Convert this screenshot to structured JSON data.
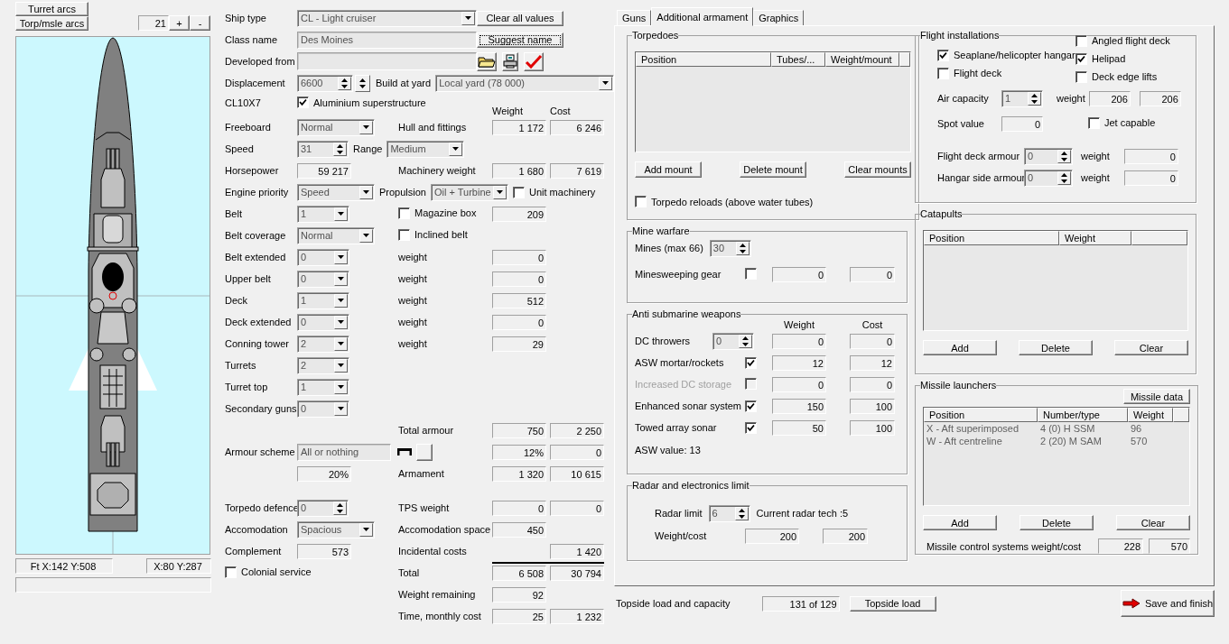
{
  "left_panel": {
    "arc_buttons": [
      "Turret arcs",
      "Torp/msle arcs"
    ],
    "zoom": {
      "value": "21",
      "buttons": [
        "+",
        "-"
      ]
    },
    "status": [
      "Ft X:142 Y:508",
      "X:80 Y:287"
    ]
  },
  "header": {
    "ship_type": {
      "label": "Ship type",
      "value": "CL - Light cruiser"
    },
    "clear_button": "Clear all values",
    "class_name": {
      "label": "Class name",
      "value": "Des Moines"
    },
    "suggest_button": {
      "label": "Suggest name",
      "focused": true
    },
    "developed_from": {
      "label": "Developed from"
    },
    "displacement": {
      "label": "Displacement",
      "value": "6600"
    },
    "yard": {
      "label": "Build at yard",
      "value": "Local yard (78 000)"
    },
    "code": "CL10X7",
    "aluminium": {
      "label": "Aluminium superstructure",
      "checked": true
    }
  },
  "columns": [
    "Weight",
    "Cost"
  ],
  "rows": [
    {
      "label": "Freeboard",
      "left": [
        {
          "kind": "dropdown",
          "value": "Normal"
        }
      ],
      "right_label": "Hull and fittings",
      "weight": "1 172",
      "cost": "6 246"
    },
    {
      "label": "Speed",
      "left": [
        {
          "kind": "spinner",
          "value": "31"
        },
        {
          "kind": "text",
          "text": "Range"
        },
        {
          "kind": "dropdown",
          "value": "Medium"
        }
      ]
    },
    {
      "label": "Horsepower",
      "left": [
        {
          "kind": "readout",
          "value": "59 217"
        }
      ],
      "right_label": "Machinery weight",
      "weight": "1 680",
      "cost": "7 619"
    },
    {
      "label": "Engine priority",
      "left": [
        {
          "kind": "dropdown",
          "value": "Speed"
        },
        {
          "kind": "text",
          "text": "Propulsion"
        },
        {
          "kind": "dropdown",
          "value": "Oil + Turbine"
        },
        {
          "kind": "checkbox",
          "label": "Unit machinery",
          "checked": false
        }
      ]
    },
    {
      "label": "Belt",
      "left": [
        {
          "kind": "narrow_dropdown",
          "value": "1"
        }
      ],
      "mid_check": {
        "label": "Magazine box",
        "checked": false
      },
      "weight": "209"
    },
    {
      "label": "Belt coverage",
      "left": [
        {
          "kind": "dropdown",
          "value": "Normal"
        }
      ],
      "mid_check": {
        "label": "Inclined belt",
        "checked": false
      }
    },
    {
      "label": "Belt extended",
      "left": [
        {
          "kind": "narrow_dropdown",
          "value": "0"
        }
      ],
      "right_label": "weight",
      "weight": "0"
    },
    {
      "label": "Upper belt",
      "left": [
        {
          "kind": "narrow_dropdown",
          "value": "0"
        }
      ],
      "right_label": "weight",
      "weight": "0"
    },
    {
      "label": "Deck",
      "left": [
        {
          "kind": "narrow_dropdown",
          "value": "1"
        }
      ],
      "right_label": "weight",
      "weight": "512"
    },
    {
      "label": "Deck extended",
      "left": [
        {
          "kind": "narrow_dropdown",
          "value": "0"
        }
      ],
      "right_label": "weight",
      "weight": "0"
    },
    {
      "label": "Conning tower",
      "left": [
        {
          "kind": "narrow_dropdown",
          "value": "2"
        }
      ],
      "right_label": "weight",
      "weight": "29"
    },
    {
      "label": "Turrets",
      "left": [
        {
          "kind": "narrow_dropdown",
          "value": "2"
        }
      ]
    },
    {
      "label": "Turret top",
      "left": [
        {
          "kind": "narrow_dropdown",
          "value": "1"
        }
      ]
    },
    {
      "label": "Secondary guns",
      "left": [
        {
          "kind": "narrow_dropdown",
          "value": "0"
        }
      ]
    },
    {
      "right_label": "Total armour",
      "weight": "750",
      "cost": "2 250"
    },
    {
      "label": "Armour scheme",
      "left": [
        {
          "kind": "field",
          "value": "All or nothing"
        },
        {
          "kind": "scheme_buttons"
        }
      ],
      "weight": "12%",
      "cost": "0"
    },
    {
      "left": [
        {
          "kind": "readout",
          "value": "20%"
        }
      ],
      "right_label": "Armament",
      "weight": "1 320",
      "cost": "10 615"
    }
  ],
  "summary_rows": [
    {
      "label": "Torpedo defence",
      "left": [
        {
          "kind": "spinner",
          "value": "0"
        }
      ],
      "right_label": "TPS weight",
      "weight": "0",
      "cost": "0"
    },
    {
      "label": "Accomodation",
      "left": [
        {
          "kind": "dropdown",
          "value": "Spacious"
        }
      ],
      "right_label": "Accomodation space",
      "weight": "450"
    },
    {
      "label": "Complement",
      "left": [
        {
          "kind": "readout",
          "value": "573"
        }
      ],
      "right_label": "Incidental costs",
      "cost": "1 420"
    },
    {
      "checkbox": {
        "label": "Colonial service",
        "checked": false
      },
      "right_label": "Total",
      "weight": "6 508",
      "cost": "30 794",
      "rule_above": true
    },
    {
      "right_label": "Weight remaining",
      "weight": "92"
    },
    {
      "right_label": "Time, monthly cost",
      "weight": "25",
      "cost": "1 232"
    }
  ],
  "tabs": [
    {
      "label": "Guns",
      "selected": false
    },
    {
      "label": "Additional armament",
      "selected": true
    },
    {
      "label": "Graphics",
      "selected": false
    }
  ],
  "torpedoes": {
    "title": "Torpedoes",
    "columns": [
      "Position",
      "Tubes/...",
      "Weight/mount"
    ],
    "buttons": [
      "Add mount",
      "Delete mount",
      "Clear mounts"
    ],
    "reloads": {
      "label": "Torpedo reloads (above water tubes)",
      "checked": false
    }
  },
  "mine_warfare": {
    "title": "Mine warfare",
    "mines": {
      "label": "Mines (max 66)",
      "value": "30"
    },
    "sweeping": {
      "label": "Minesweeping gear",
      "checked": false,
      "weight": "0",
      "cost": "0"
    }
  },
  "asw": {
    "title": "Anti submarine weapons",
    "columns": [
      "Weight",
      "Cost"
    ],
    "items": [
      {
        "kind": "spinner",
        "label": "DC throwers",
        "value": "0",
        "disabled": false,
        "weight": "0",
        "cost": "0"
      },
      {
        "kind": "checkbox",
        "label": "ASW mortar/rockets",
        "checked": true,
        "disabled": false,
        "weight": "12",
        "cost": "12"
      },
      {
        "kind": "checkbox",
        "label": "Increased DC storage",
        "checked": false,
        "disabled": true,
        "weight": "0",
        "cost": "0"
      },
      {
        "kind": "checkbox",
        "label": "Enhanced sonar system",
        "checked": true,
        "disabled": false,
        "weight": "150",
        "cost": "100"
      },
      {
        "kind": "checkbox",
        "label": "Towed array sonar",
        "checked": true,
        "disabled": false,
        "weight": "50",
        "cost": "100"
      }
    ],
    "value": "ASW value: 13"
  },
  "radar": {
    "title": "Radar and electronics limit",
    "limit": {
      "label": "Radar limit",
      "value": "6"
    },
    "tech": "Current radar tech :5",
    "weight_cost": {
      "label": "Weight/cost",
      "weight": "200",
      "cost": "200"
    }
  },
  "flight": {
    "title": "Flight installations",
    "left_checks": [
      {
        "label": "Seaplane/helicopter hangar",
        "checked": true
      },
      {
        "label": "Flight deck",
        "checked": false
      }
    ],
    "right_checks": [
      {
        "label": "Angled flight deck",
        "checked": false
      },
      {
        "label": "Helipad",
        "checked": true
      },
      {
        "label": "Deck edge lifts",
        "checked": false
      }
    ],
    "air_capacity": {
      "label": "Air capacity",
      "value": "1",
      "weight_label": "weight",
      "weight": "206",
      "cost": "206"
    },
    "spot": {
      "label": "Spot value",
      "value": "0"
    },
    "jet": {
      "label": "Jet capable",
      "checked": false
    },
    "armour": [
      {
        "label": "Flight deck armour",
        "value": "0",
        "weight_label": "weight",
        "weight": "0"
      },
      {
        "label": "Hangar side armour",
        "value": "0",
        "weight_label": "weight",
        "weight": "0"
      }
    ]
  },
  "catapults": {
    "title": "Catapults",
    "columns": [
      "Position",
      "Weight"
    ],
    "buttons": [
      "Add",
      "Delete",
      "Clear"
    ]
  },
  "missiles": {
    "title": "Missile launchers",
    "data_button": "Missile data",
    "columns": [
      "Position",
      "Number/type",
      "Weight"
    ],
    "rows": [
      {
        "position": "X - Aft superimposed",
        "number_type": "4 (0) H SSM",
        "weight": "96"
      },
      {
        "position": "W - Aft centreline",
        "number_type": "2 (20) M SAM",
        "weight": "570"
      }
    ],
    "buttons": [
      "Add",
      "Delete",
      "Clear"
    ],
    "control": {
      "label": "Missile control systems weight/cost",
      "weight": "228",
      "cost": "570"
    }
  },
  "topside": {
    "label": "Topside load and capacity",
    "value": "131 of 129",
    "button": "Topside load"
  },
  "save_button": "Save and finish"
}
